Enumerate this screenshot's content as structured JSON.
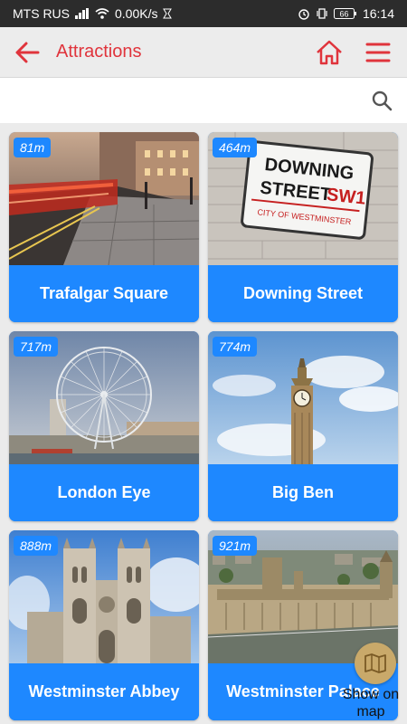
{
  "status": {
    "carrier": "MTS RUS",
    "speed": "0.00K/s",
    "battery": "66",
    "time": "16:14"
  },
  "header": {
    "title": "Attractions",
    "colors": {
      "accent": "#e0343c",
      "card": "#1e88ff"
    }
  },
  "search": {
    "value": "",
    "placeholder": ""
  },
  "attractions": [
    {
      "name": "Trafalgar Square",
      "distance": "81m",
      "image": "street-night-photo"
    },
    {
      "name": "Downing Street",
      "distance": "464m",
      "image": "street-sign-photo",
      "sign": {
        "line1": "DOWNING",
        "line2": "STREET",
        "code": "SW1",
        "line3": "CITY OF WESTMINSTER"
      }
    },
    {
      "name": "London Eye",
      "distance": "717m",
      "image": "ferris-wheel-photo"
    },
    {
      "name": "Big Ben",
      "distance": "774m",
      "image": "clock-tower-photo"
    },
    {
      "name": "Westminster Abbey",
      "distance": "888m",
      "image": "abbey-photo"
    },
    {
      "name": "Westminster Palace",
      "distance": "921m",
      "image": "palace-aerial-photo"
    }
  ],
  "map_button": {
    "label": "Show on map",
    "icon": "map-icon"
  }
}
